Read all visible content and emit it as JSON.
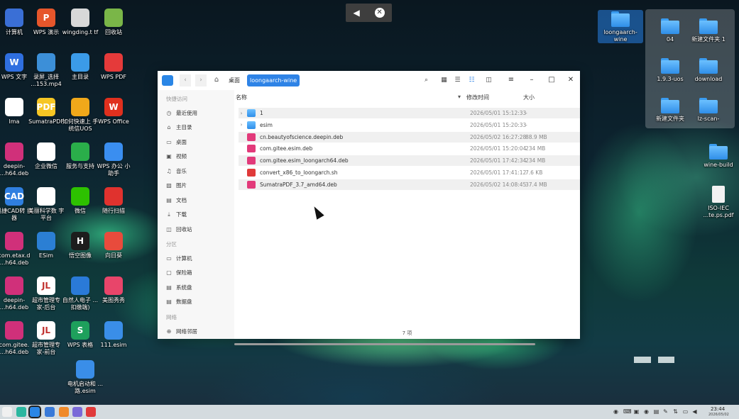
{
  "floatbar": {
    "play_icon": "flag-icon",
    "close_icon": "close-circle-icon",
    "close_glyph": "✕",
    "play_glyph": "◀"
  },
  "desktop": {
    "left_icons": [
      {
        "label": "计算机",
        "color": "#3a6fd6"
      },
      {
        "label": "WPS 演示",
        "color": "#e6562b",
        "glyph": "P"
      },
      {
        "label": "wingding.t tf",
        "color": "#d8d8d8"
      },
      {
        "label": "回收站",
        "color": "#7ab648"
      },
      {
        "label": "WPS 文字",
        "color": "#2f6fe0",
        "glyph": "W"
      },
      {
        "label": "录屏_选择 ...153.mp4",
        "color": "#3c8fd8"
      },
      {
        "label": "主目录",
        "color": "#3b9be8"
      },
      {
        "label": "WPS PDF",
        "color": "#e53a3a"
      },
      {
        "label": "lma",
        "color": "#ffffff"
      },
      {
        "label": "SumatraPDF",
        "color": "#f6c624",
        "glyph": "PDF"
      },
      {
        "label": "如何快速上 手统信UOS",
        "color": "#f0a81a"
      },
      {
        "label": "WPS Office",
        "color": "#e0301e",
        "glyph": "W"
      },
      {
        "label": "deepin- ...h64.deb",
        "color": "#d0307a"
      },
      {
        "label": "企业微信",
        "color": "#ffffff"
      },
      {
        "label": "服务与支持",
        "color": "#2aae4a"
      },
      {
        "label": "WPS 办公 小助手",
        "color": "#3a8ef0"
      },
      {
        "label": "迅捷CAD转 换器",
        "color": "#2f7fe0",
        "glyph": "CAD"
      },
      {
        "label": "美丽科学数 字平台",
        "color": "#ffffff"
      },
      {
        "label": "微信",
        "color": "#2dc100"
      },
      {
        "label": "随行扫描",
        "color": "#e0322e"
      },
      {
        "label": "com.etax.d ...h64.deb",
        "color": "#d0307a"
      },
      {
        "label": "ESim",
        "color": "#2b7fd4"
      },
      {
        "label": "悟空图像",
        "color": "#1d1d1d",
        "glyph": "H"
      },
      {
        "label": "向日葵",
        "color": "#e84b3c"
      },
      {
        "label": "deepin- ...h64.deb",
        "color": "#d0307a"
      },
      {
        "label": "超市管理专 家-后台",
        "color": "#ffffff",
        "glyph": "JL"
      },
      {
        "label": "自然人电子 ...扣缴端)",
        "color": "#2a7ad8"
      },
      {
        "label": "美图秀秀",
        "color": "#e8456a"
      },
      {
        "label": "com.gitee. ...h64.deb",
        "color": "#d0307a"
      },
      {
        "label": "超市管理专 家-前台",
        "color": "#ffffff",
        "glyph": "JL"
      },
      {
        "label": "WPS 表格",
        "color": "#1ea05c",
        "glyph": "S"
      },
      {
        "label": "111.esim",
        "color": "#3a8ee8"
      },
      {
        "label": "电机启动和 ...路.esim",
        "color": "#3a8ee8"
      }
    ],
    "selected_folder": "loongaarch-wine",
    "recent_panel": [
      "04",
      "新建文件夹 1",
      "1.9.3-uos",
      "download",
      "新建文件夹",
      "lz-scan-"
    ],
    "right_icons": [
      "wine-build",
      "ISO-IEC ...te.ps.pdf"
    ]
  },
  "fm": {
    "breadcrumb": [
      "桌面",
      "loongaarch-wine"
    ],
    "columns": {
      "name": "名称",
      "modified": "修改时间",
      "size": "大小"
    },
    "sidebar": {
      "group_quick": "快捷访问",
      "quick": [
        {
          "label": "最近使用",
          "icon": "clock-icon",
          "glyph": "◷"
        },
        {
          "label": "主目录",
          "icon": "home-icon",
          "glyph": "⌂"
        },
        {
          "label": "桌面",
          "icon": "desktop-icon",
          "glyph": "▭"
        },
        {
          "label": "视频",
          "icon": "video-icon",
          "glyph": "▣"
        },
        {
          "label": "音乐",
          "icon": "music-icon",
          "glyph": "♫"
        },
        {
          "label": "图片",
          "icon": "picture-icon",
          "glyph": "▨"
        },
        {
          "label": "文档",
          "icon": "document-icon",
          "glyph": "▤"
        },
        {
          "label": "下载",
          "icon": "download-icon",
          "glyph": "⤓"
        },
        {
          "label": "回收站",
          "icon": "trash-icon",
          "glyph": "◫"
        }
      ],
      "group_partition": "分区",
      "partitions": [
        {
          "label": "计算机",
          "icon": "computer-icon",
          "glyph": "▭"
        },
        {
          "label": "保险箱",
          "icon": "safe-icon",
          "glyph": "▢"
        },
        {
          "label": "系统盘",
          "icon": "disk-icon",
          "glyph": "▤"
        },
        {
          "label": "数据盘",
          "icon": "disk-icon",
          "glyph": "▤"
        }
      ],
      "group_network": "网络",
      "network": [
        {
          "label": "网络邻居",
          "icon": "network-icon",
          "glyph": "⊕"
        }
      ]
    },
    "files": [
      {
        "name": "1",
        "type": "folder",
        "modified": "2026/05/01 15:12:33",
        "size": "-"
      },
      {
        "name": "esim",
        "type": "folder",
        "modified": "2026/05/01 15:20:33",
        "size": "-"
      },
      {
        "name": "cn.beautyofscience.deepin.deb",
        "type": "deb",
        "modified": "2026/05/02 16:27:28",
        "size": "88.9 MB"
      },
      {
        "name": "com.gitee.esim.deb",
        "type": "deb",
        "modified": "2026/05/01 15:20:04",
        "size": "234 MB"
      },
      {
        "name": "com.gitee.esim_loongarch64.deb",
        "type": "deb",
        "modified": "2026/05/01 17:42:34",
        "size": "234 MB"
      },
      {
        "name": "convert_x86_to_loongarch.sh",
        "type": "sh",
        "modified": "2026/05/01 17:41:12",
        "size": "7.6 KB"
      },
      {
        "name": "SumatraPDF_3.7_amd64.deb",
        "type": "deb",
        "modified": "2026/05/02 14:08:45",
        "size": "37.4 MB"
      }
    ],
    "status": "7 项"
  },
  "taskbar": {
    "apps": [
      {
        "name": "launcher-icon",
        "color": "#f0f0f0"
      },
      {
        "name": "multitask-icon",
        "color": "#2bb7a0"
      },
      {
        "name": "file-manager-icon",
        "color": "#2a86e6"
      },
      {
        "name": "browser-icon",
        "color": "#3a7ad8"
      },
      {
        "name": "app-store-icon",
        "color": "#f08a2a"
      },
      {
        "name": "settings-icon",
        "color": "#7a6ad8"
      },
      {
        "name": "pdf-reader-icon",
        "color": "#e03a3a"
      }
    ],
    "time": "23:44",
    "date": "2026/05/02"
  }
}
